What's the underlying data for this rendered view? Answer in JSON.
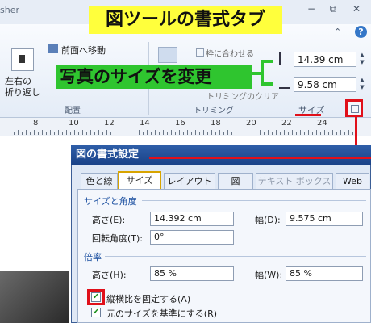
{
  "window": {
    "app_title": "sher",
    "minimize": "−",
    "restore": "⧉",
    "close": "✕",
    "help": "?",
    "expand": "⌃"
  },
  "banner": "図ツールの書式タブ",
  "callout": "写真のサイズを変更",
  "ribbon": {
    "wrap_label": "左右の\n折り返し",
    "bring_front": "前面へ移動",
    "group_arrange": "配置",
    "fit_frame": "枠に合わせる",
    "trim_clear": "トリミングのクリア",
    "group_trim": "トリミング",
    "height_value": "14.39 cm",
    "width_value": "9.58 cm",
    "group_size": "サイズ"
  },
  "ruler": {
    "numbers": [
      "8",
      "10",
      "12",
      "14",
      "16",
      "18",
      "20",
      "22",
      "24"
    ]
  },
  "dialog": {
    "title": "図の書式設定",
    "tabs": [
      "色と線",
      "サイズ",
      "レイアウト",
      "図",
      "テキスト ボックス",
      "Web"
    ],
    "section_size": "サイズと角度",
    "height_label": "高さ(E):",
    "height_value": "14.392 cm",
    "width_label": "幅(D):",
    "width_value": "9.575 cm",
    "rotation_label": "回転角度(T):",
    "rotation_value": "0°",
    "section_scale": "倍率",
    "scale_h_label": "高さ(H):",
    "scale_h_value": "85 %",
    "scale_w_label": "幅(W):",
    "scale_w_value": "85 %",
    "lock_aspect": "縦横比を固定する(A)",
    "relative_original": "元のサイズを基準にする(R)"
  },
  "colors": {
    "banner": "#ffff3c",
    "callout": "#2fc52f",
    "highlight": "#e0101a",
    "dialog_title": "#1a4288"
  }
}
